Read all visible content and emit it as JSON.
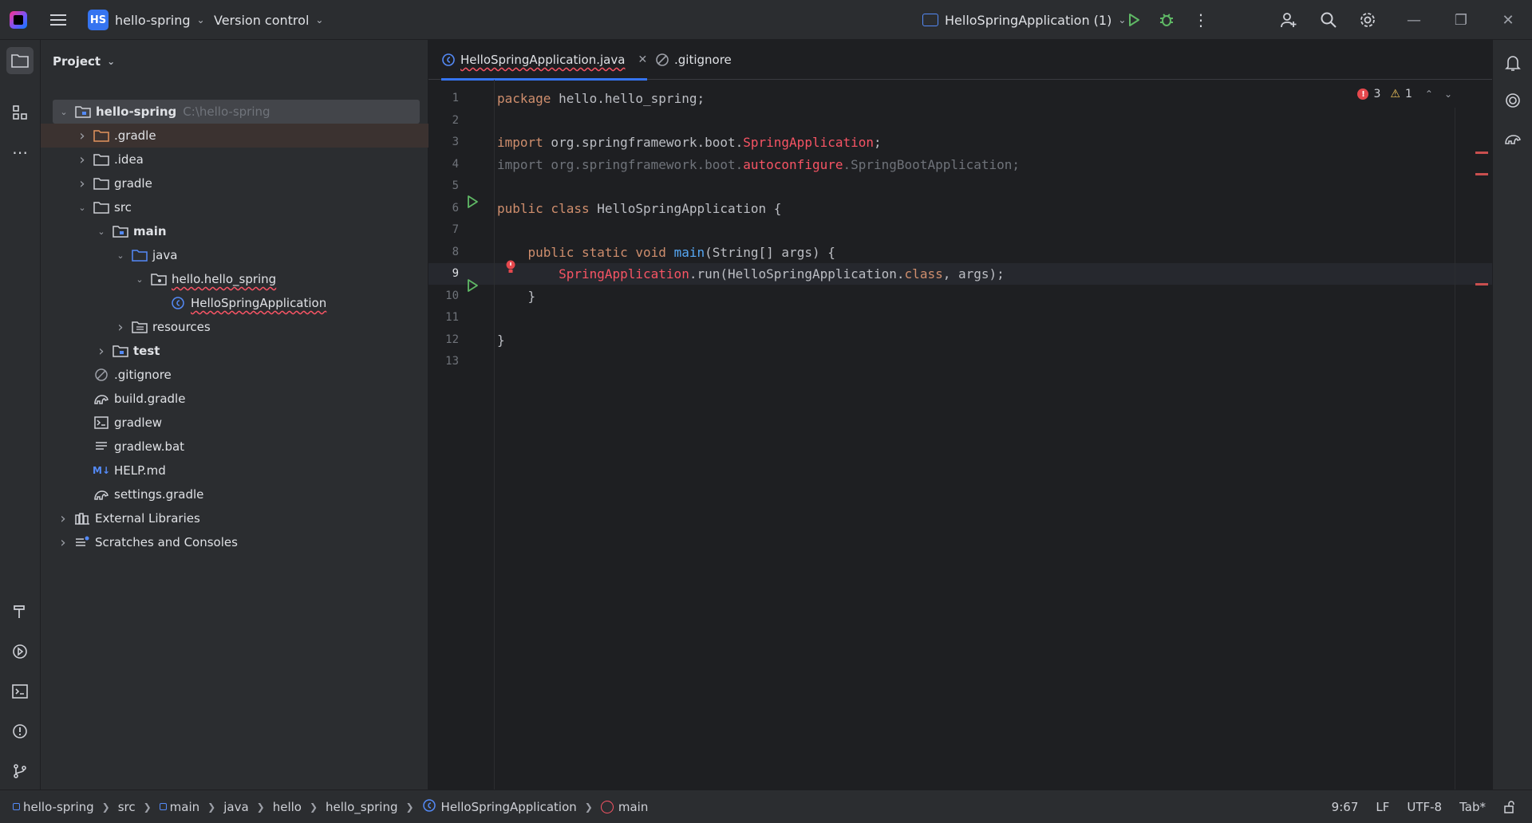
{
  "titlebar": {
    "project_badge": "HS",
    "project_name": "hello-spring",
    "vcs_label": "Version control",
    "run_config": "HelloSpringApplication (1)"
  },
  "project_panel": {
    "title": "Project",
    "tree": [
      {
        "label": "hello-spring",
        "path": "C:\\hello-spring",
        "depth": 0,
        "expanded": true,
        "icon": "module-folder-icon",
        "bold": true
      },
      {
        "label": ".gradle",
        "depth": 1,
        "expanded": false,
        "icon": "folder-orange-icon"
      },
      {
        "label": ".idea",
        "depth": 1,
        "expanded": false,
        "icon": "folder-icon"
      },
      {
        "label": "gradle",
        "depth": 1,
        "expanded": false,
        "icon": "folder-icon"
      },
      {
        "label": "src",
        "depth": 1,
        "expanded": true,
        "icon": "folder-icon"
      },
      {
        "label": "main",
        "depth": 2,
        "expanded": true,
        "icon": "module-folder-icon",
        "bold": true
      },
      {
        "label": "java",
        "depth": 3,
        "expanded": true,
        "icon": "source-folder-icon"
      },
      {
        "label": "hello.hello_spring",
        "depth": 4,
        "expanded": true,
        "icon": "package-icon",
        "error": true
      },
      {
        "label": "HelloSpringApplication",
        "depth": 5,
        "icon": "spring-class-icon",
        "error": true
      },
      {
        "label": "resources",
        "depth": 3,
        "expanded": false,
        "icon": "resources-folder-icon"
      },
      {
        "label": "test",
        "depth": 2,
        "expanded": false,
        "icon": "module-folder-icon",
        "bold": true
      },
      {
        "label": ".gitignore",
        "depth": 1,
        "icon": "gitignore-icon"
      },
      {
        "label": "build.gradle",
        "depth": 1,
        "icon": "gradle-icon"
      },
      {
        "label": "gradlew",
        "depth": 1,
        "icon": "terminal-file-icon"
      },
      {
        "label": "gradlew.bat",
        "depth": 1,
        "icon": "text-file-icon"
      },
      {
        "label": "HELP.md",
        "depth": 1,
        "icon": "markdown-icon"
      },
      {
        "label": "settings.gradle",
        "depth": 1,
        "icon": "gradle-icon"
      },
      {
        "label": "External Libraries",
        "depth": 0,
        "expanded": false,
        "icon": "libraries-icon"
      },
      {
        "label": "Scratches and Consoles",
        "depth": 0,
        "expanded": false,
        "icon": "scratches-icon"
      }
    ]
  },
  "editor": {
    "tabs": [
      {
        "label": "HelloSpringApplication.java",
        "active": true
      },
      {
        "label": ".gitignore",
        "active": false
      }
    ],
    "inspections": {
      "errors": "3",
      "warnings": "1"
    },
    "current_line": 9,
    "lines": [
      [
        [
          "kw",
          "package"
        ],
        [
          "t",
          " hello.hello_spring;"
        ]
      ],
      [],
      [
        [
          "kw",
          "import"
        ],
        [
          "t",
          " org.springframework.boot."
        ],
        [
          "err",
          "SpringApplication"
        ],
        [
          "t",
          ";"
        ]
      ],
      [
        [
          "gray",
          "import org.springframework.boot."
        ],
        [
          "err",
          "autoconfigure"
        ],
        [
          "gray",
          ".SpringBootApplication;"
        ]
      ],
      [],
      [
        [
          "kw",
          "public class"
        ],
        [
          "t",
          " HelloSpringApplication {"
        ]
      ],
      [],
      [
        [
          "t",
          "    "
        ],
        [
          "kw",
          "public static void"
        ],
        [
          "t",
          " "
        ],
        [
          "fn",
          "main"
        ],
        [
          "t",
          "(String[] args) {"
        ]
      ],
      [
        [
          "t",
          "        "
        ],
        [
          "err",
          "SpringApplication"
        ],
        [
          "t",
          ".run(HelloSpringApplication."
        ],
        [
          "kw",
          "class"
        ],
        [
          "t",
          ", args);"
        ]
      ],
      [
        [
          "t",
          "    }"
        ]
      ],
      [],
      [
        [
          "t",
          "}"
        ]
      ],
      []
    ]
  },
  "statusbar": {
    "breadcrumbs": [
      "hello-spring",
      "src",
      "main",
      "java",
      "hello",
      "hello_spring",
      "HelloSpringApplication",
      "main"
    ],
    "position": "9:67",
    "line_sep": "LF",
    "encoding": "UTF-8",
    "indent": "Tab*"
  },
  "colors": {
    "accent": "#3574f0",
    "error": "#f75464",
    "keyword": "#cf8e6d",
    "function": "#56a8f5",
    "run_green": "#5fb865"
  }
}
